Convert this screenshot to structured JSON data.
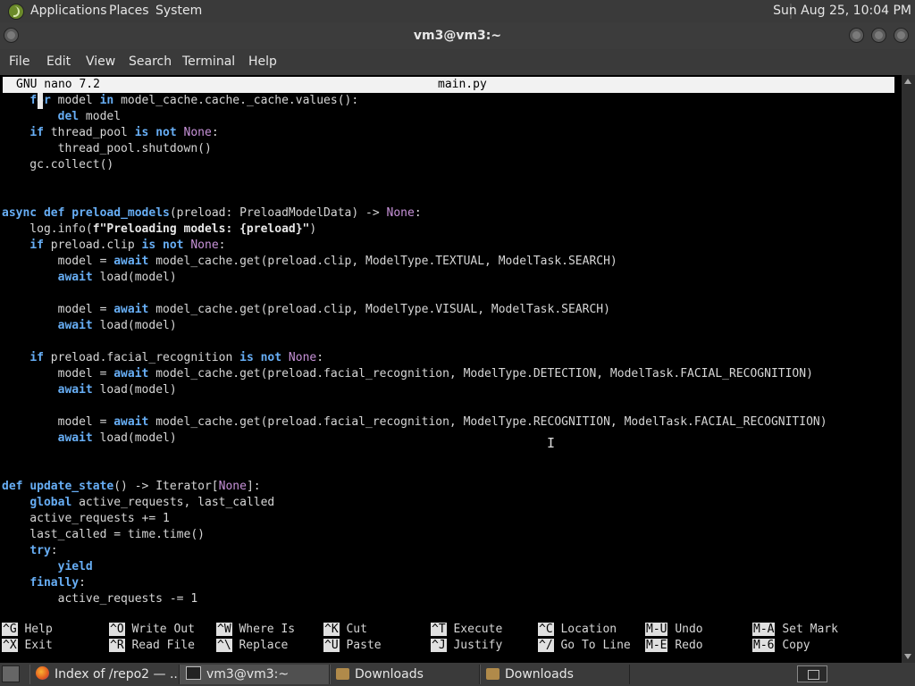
{
  "top_panel": {
    "menus": [
      "Applications",
      "Places",
      "System"
    ],
    "clock": "Sun Aug 25, 10:04 PM"
  },
  "window": {
    "title": "vm3@vm3:~",
    "menu": [
      "File",
      "Edit",
      "View",
      "Search",
      "Terminal",
      "Help"
    ]
  },
  "nano": {
    "version": "GNU nano 7.2",
    "filename": "main.py",
    "shortcuts": [
      {
        "key": "^G",
        "label": "Help"
      },
      {
        "key": "^X",
        "label": "Exit"
      },
      {
        "key": "^O",
        "label": "Write Out"
      },
      {
        "key": "^R",
        "label": "Read File"
      },
      {
        "key": "^W",
        "label": "Where Is"
      },
      {
        "key": "^\\",
        "label": "Replace"
      },
      {
        "key": "^K",
        "label": "Cut"
      },
      {
        "key": "^U",
        "label": "Paste"
      },
      {
        "key": "^T",
        "label": "Execute"
      },
      {
        "key": "^J",
        "label": "Justify"
      },
      {
        "key": "^C",
        "label": "Location"
      },
      {
        "key": "^/",
        "label": "Go To Line"
      },
      {
        "key": "M-U",
        "label": "Undo"
      },
      {
        "key": "M-E",
        "label": "Redo"
      },
      {
        "key": "M-A",
        "label": "Set Mark"
      },
      {
        "key": "M-6",
        "label": "Copy"
      }
    ]
  },
  "code_lines": [
    [
      [
        "    ",
        ""
      ],
      [
        "for",
        "kw"
      ],
      [
        " model ",
        ""
      ],
      [
        "in",
        "kw"
      ],
      [
        " model_cache.cache._cache.values():",
        ""
      ]
    ],
    [
      [
        "        ",
        ""
      ],
      [
        "del",
        "kw"
      ],
      [
        " model",
        ""
      ]
    ],
    [
      [
        "    ",
        ""
      ],
      [
        "if",
        "kw"
      ],
      [
        " thread_pool ",
        ""
      ],
      [
        "is",
        "kw"
      ],
      [
        " ",
        ""
      ],
      [
        "not",
        "kw"
      ],
      [
        " ",
        ""
      ],
      [
        "None",
        "nn"
      ],
      [
        ":",
        ""
      ]
    ],
    [
      [
        "        thread_pool.shutdown()",
        ""
      ]
    ],
    [
      [
        "    gc.collect()",
        ""
      ]
    ],
    [],
    [],
    [
      [
        "async",
        "kw"
      ],
      [
        " ",
        ""
      ],
      [
        "def",
        "kw"
      ],
      [
        " ",
        ""
      ],
      [
        "preload_models",
        "fn"
      ],
      [
        "(preload: PreloadModelData) -> ",
        ""
      ],
      [
        "None",
        "nn"
      ],
      [
        ":",
        ""
      ]
    ],
    [
      [
        "    log.info(",
        ""
      ],
      [
        "f\"Preloading models: {preload}\"",
        "st"
      ],
      [
        ")",
        ""
      ]
    ],
    [
      [
        "    ",
        ""
      ],
      [
        "if",
        "kw"
      ],
      [
        " preload.clip ",
        ""
      ],
      [
        "is",
        "kw"
      ],
      [
        " ",
        ""
      ],
      [
        "not",
        "kw"
      ],
      [
        " ",
        ""
      ],
      [
        "None",
        "nn"
      ],
      [
        ":",
        ""
      ]
    ],
    [
      [
        "        model = ",
        ""
      ],
      [
        "await",
        "kw"
      ],
      [
        " model_cache.get(preload.clip, ModelType.TEXTUAL, ModelTask.SEARCH)",
        ""
      ]
    ],
    [
      [
        "        ",
        ""
      ],
      [
        "await",
        "kw"
      ],
      [
        " load(model)",
        ""
      ]
    ],
    [],
    [
      [
        "        model = ",
        ""
      ],
      [
        "await",
        "kw"
      ],
      [
        " model_cache.get(preload.clip, ModelType.VISUAL, ModelTask.SEARCH)",
        ""
      ]
    ],
    [
      [
        "        ",
        ""
      ],
      [
        "await",
        "kw"
      ],
      [
        " load(model)",
        ""
      ]
    ],
    [],
    [
      [
        "    ",
        ""
      ],
      [
        "if",
        "kw"
      ],
      [
        " preload.facial_recognition ",
        ""
      ],
      [
        "is",
        "kw"
      ],
      [
        " ",
        ""
      ],
      [
        "not",
        "kw"
      ],
      [
        " ",
        ""
      ],
      [
        "None",
        "nn"
      ],
      [
        ":",
        ""
      ]
    ],
    [
      [
        "        model = ",
        ""
      ],
      [
        "await",
        "kw"
      ],
      [
        " model_cache.get(preload.facial_recognition, ModelType.DETECTION, ModelTask.FACIAL_RECOGNITION)",
        ""
      ]
    ],
    [
      [
        "        ",
        ""
      ],
      [
        "await",
        "kw"
      ],
      [
        " load(model)",
        ""
      ]
    ],
    [],
    [
      [
        "        model = ",
        ""
      ],
      [
        "await",
        "kw"
      ],
      [
        " model_cache.get(preload.facial_recognition, ModelType.RECOGNITION, ModelTask.FACIAL_RECOGNITION)",
        ""
      ]
    ],
    [
      [
        "        ",
        ""
      ],
      [
        "await",
        "kw"
      ],
      [
        " load(model)",
        ""
      ]
    ],
    [],
    [],
    [
      [
        "def",
        "kw"
      ],
      [
        " ",
        ""
      ],
      [
        "update_state",
        "fn"
      ],
      [
        "() -> Iterator[",
        ""
      ],
      [
        "None",
        "nn"
      ],
      [
        "]:",
        ""
      ]
    ],
    [
      [
        "    ",
        ""
      ],
      [
        "global",
        "kw"
      ],
      [
        " active_requests, last_called",
        ""
      ]
    ],
    [
      [
        "    active_requests += 1",
        ""
      ]
    ],
    [
      [
        "    last_called = time.time()",
        ""
      ]
    ],
    [
      [
        "    ",
        ""
      ],
      [
        "try",
        "kw"
      ],
      [
        ":",
        ""
      ]
    ],
    [
      [
        "        ",
        ""
      ],
      [
        "yield",
        "kw"
      ]
    ],
    [
      [
        "    ",
        ""
      ],
      [
        "finally",
        "kw"
      ],
      [
        ":",
        ""
      ]
    ],
    [
      [
        "        active_requests -= 1",
        ""
      ]
    ]
  ],
  "taskbar": {
    "tasks": [
      {
        "label": "Index of /repo2 — ...",
        "icon": "firefox-icon"
      },
      {
        "label": "vm3@vm3:~",
        "icon": "terminal-icon"
      },
      {
        "label": "Downloads",
        "icon": "folder-icon"
      },
      {
        "label": "Downloads",
        "icon": "folder-icon"
      }
    ]
  }
}
